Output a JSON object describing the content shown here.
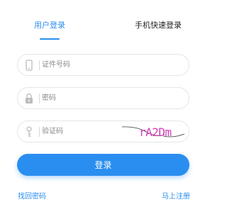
{
  "tabs": {
    "user_login": "用户登录",
    "phone_login": "手机快速登录",
    "active": "user_login"
  },
  "form": {
    "id_placeholder": "证件号码",
    "password_placeholder": "密码",
    "captcha_placeholder": "验证码",
    "captcha_text": "rA2Dm",
    "login_label": "登录"
  },
  "links": {
    "forgot": "找回密码",
    "register": "马上注册"
  },
  "colors": {
    "accent": "#2a8ef0",
    "captcha_text": "#d63fb8",
    "border": "#e6e6e6",
    "icon": "#bdbdbd"
  },
  "icons": [
    "phone-icon",
    "lock-icon",
    "key-icon"
  ]
}
